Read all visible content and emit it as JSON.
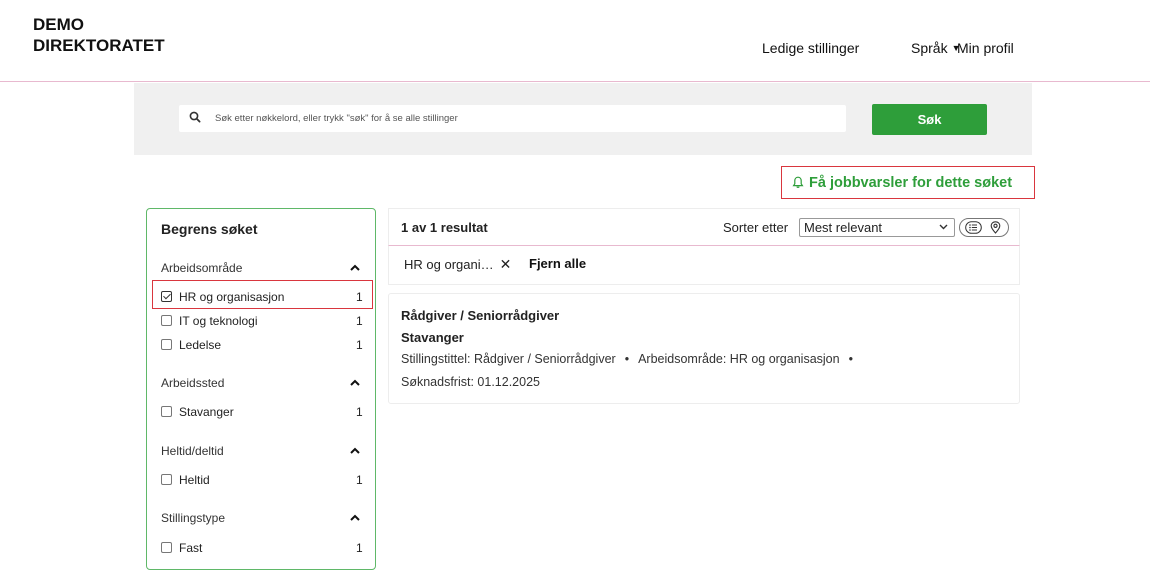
{
  "header": {
    "logo_line1": "DEMO",
    "logo_line2": "DIREKTORATET",
    "nav": {
      "ledige": "Ledige stillinger",
      "sprak": "Språk",
      "profil": "Min profil"
    }
  },
  "search": {
    "placeholder": "Søk etter nøkkelord, eller trykk \"søk\" for å se alle stillinger",
    "button": "Søk"
  },
  "jobbvarsel": {
    "label": "Få jobbvarsler for dette søket"
  },
  "filters": {
    "title": "Begrens søket",
    "groups": [
      {
        "title": "Arbeidsområde",
        "options": [
          {
            "label": "HR og organisasjon",
            "count": "1",
            "checked": true
          },
          {
            "label": "IT og teknologi",
            "count": "1",
            "checked": false
          },
          {
            "label": "Ledelse",
            "count": "1",
            "checked": false
          }
        ]
      },
      {
        "title": "Arbeidssted",
        "options": [
          {
            "label": "Stavanger",
            "count": "1",
            "checked": false
          }
        ]
      },
      {
        "title": "Heltid/deltid",
        "options": [
          {
            "label": "Heltid",
            "count": "1",
            "checked": false
          }
        ]
      },
      {
        "title": "Stillingstype",
        "options": [
          {
            "label": "Fast",
            "count": "1",
            "checked": false
          }
        ]
      }
    ]
  },
  "results": {
    "count_label": "1 av 1 resultat",
    "sort_label": "Sorter etter",
    "sort_value": "Mest relevant",
    "active_chip": "HR og organi…",
    "chip_remove": "✕",
    "clear_all": "Fjern alle",
    "items": [
      {
        "title": "Rådgiver / Seniorrådgiver",
        "location": "Stavanger",
        "meta1": "Stillingstittel: Rådgiver / Seniorrådgiver",
        "meta2": "Arbeidsområde: HR og organisasjon",
        "deadline": "Søknadsfrist: 01.12.2025"
      }
    ]
  },
  "colors": {
    "accent_green": "#2e9e3a",
    "highlight_red": "#d9363e",
    "header_rule": "#e8b9cf"
  }
}
